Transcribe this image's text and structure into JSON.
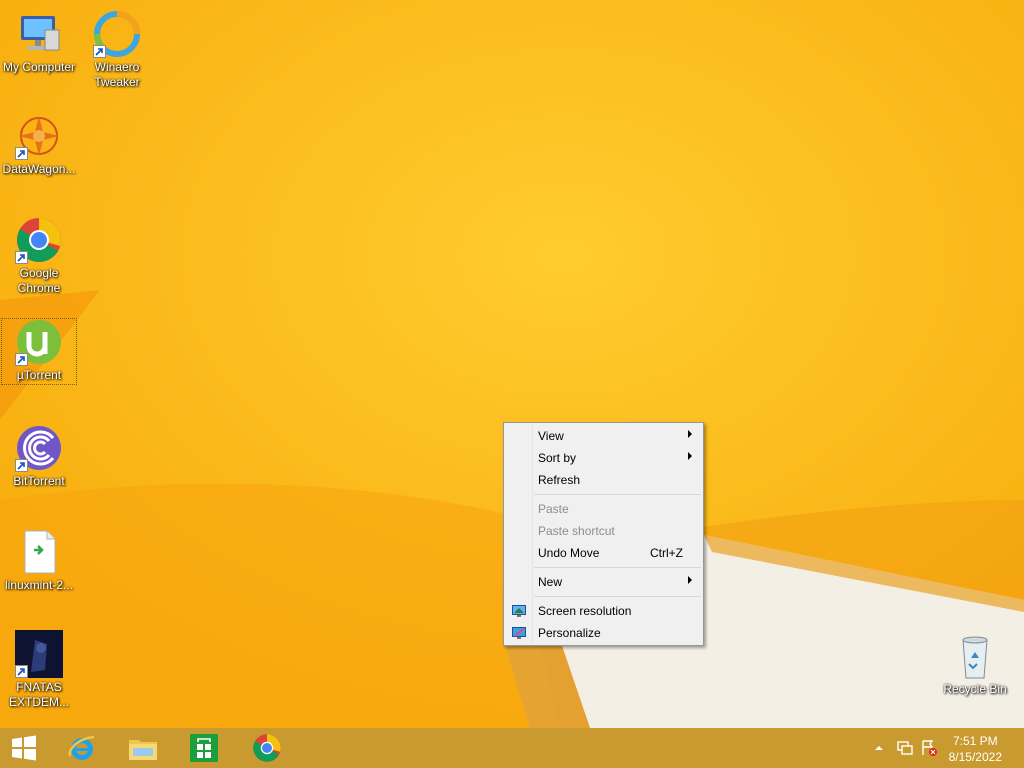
{
  "desktop": {
    "icons": [
      {
        "label": "My Computer",
        "icon": "computer-icon"
      },
      {
        "label": "Winaero\nTweaker",
        "icon": "winaero-tweaker-icon"
      },
      {
        "label": "DataWagon...",
        "icon": "datawagon-icon"
      },
      {
        "label": "Google\nChrome",
        "icon": "chrome-icon"
      },
      {
        "label": "µTorrent",
        "icon": "utorrent-icon"
      },
      {
        "label": "BitTorrent",
        "icon": "bittorrent-icon"
      },
      {
        "label": "linuxmint-2...",
        "icon": "file-icon"
      },
      {
        "label": "FNATAS\nEXTDEM...",
        "icon": "fnatas-icon"
      },
      {
        "label": "Recycle Bin",
        "icon": "recycle-bin-icon"
      }
    ]
  },
  "context_menu": {
    "items": [
      {
        "label": "View",
        "submenu": true
      },
      {
        "label": "Sort by",
        "submenu": true
      },
      {
        "label": "Refresh"
      },
      {
        "label": "Paste",
        "disabled": true
      },
      {
        "label": "Paste shortcut",
        "disabled": true
      },
      {
        "label": "Undo Move",
        "shortcut": "Ctrl+Z"
      },
      {
        "label": "New",
        "submenu": true
      },
      {
        "label": "Screen resolution",
        "icon": "screen-resolution-icon"
      },
      {
        "label": "Personalize",
        "icon": "personalize-icon"
      }
    ]
  },
  "taskbar": {
    "pinned": [
      "start-button",
      "internet-explorer-icon",
      "file-explorer-icon",
      "store-icon",
      "chrome-icon"
    ],
    "tray_icons": [
      "show-hidden-icons-arrow",
      "network-icon",
      "action-center-icon"
    ],
    "clock": {
      "time": "7:51 PM",
      "date": "8/15/2022"
    }
  },
  "colors": {
    "wallpaper": "#fbbb15",
    "taskbar": "#c99a2f",
    "menu_bg": "#f0f0f0"
  }
}
